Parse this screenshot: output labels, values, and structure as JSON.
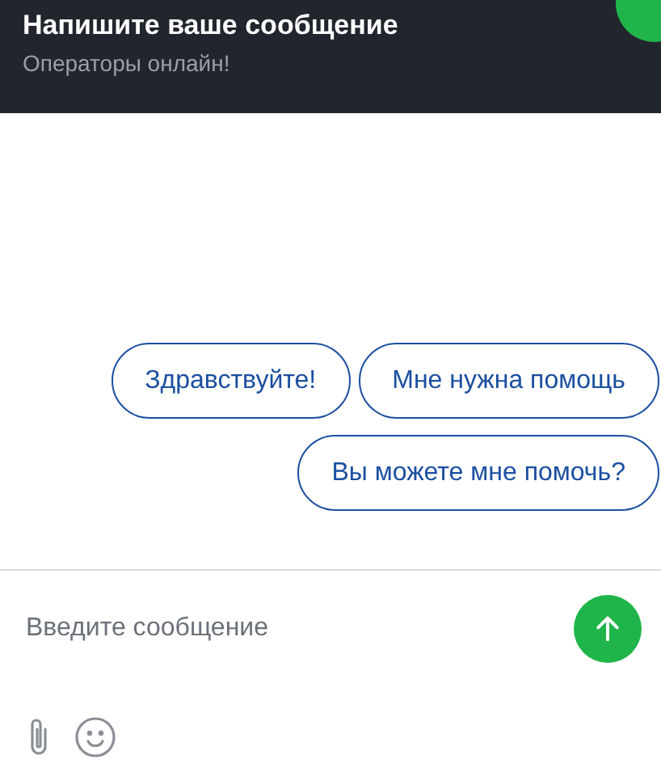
{
  "header": {
    "title": "Напишите ваше сообщение",
    "subtitle": "Операторы онлайн!"
  },
  "quick_replies": [
    {
      "label": "Здравствуйте!"
    },
    {
      "label": "Мне нужна помощь"
    },
    {
      "label": "Вы можете мне помочь?"
    }
  ],
  "composer": {
    "placeholder": "Введите сообщение"
  }
}
